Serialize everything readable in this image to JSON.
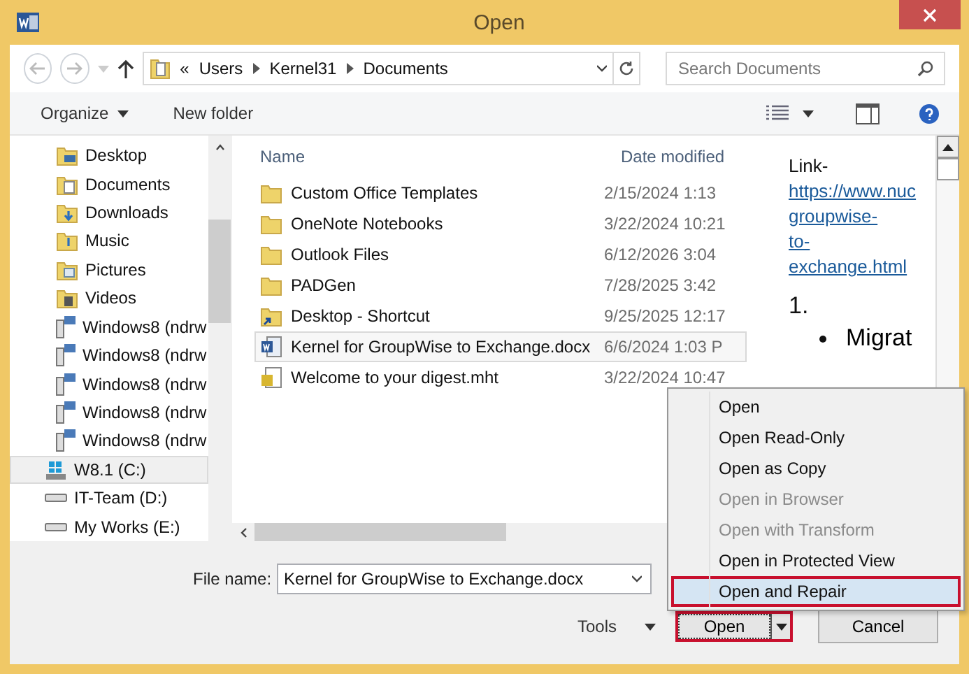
{
  "window": {
    "title": "Open"
  },
  "address": {
    "prefix": "«",
    "crumbs": [
      "Users",
      "Kernel31",
      "Documents"
    ]
  },
  "search": {
    "placeholder": "Search Documents"
  },
  "toolbar": [
    "Organize",
    "New folder"
  ],
  "sidebar": [
    {
      "label": "Desktop",
      "kind": "desktop",
      "selected": false
    },
    {
      "label": "Documents",
      "kind": "documents",
      "selected": false
    },
    {
      "label": "Downloads",
      "kind": "downloads",
      "selected": false
    },
    {
      "label": "Music",
      "kind": "music",
      "selected": false
    },
    {
      "label": "Pictures",
      "kind": "pictures",
      "selected": false
    },
    {
      "label": "Videos",
      "kind": "videos",
      "selected": false
    },
    {
      "label": "Windows8 (ndrw",
      "kind": "network",
      "selected": false
    },
    {
      "label": "Windows8 (ndrw",
      "kind": "network",
      "selected": false
    },
    {
      "label": "Windows8 (ndrw",
      "kind": "network",
      "selected": false
    },
    {
      "label": "Windows8 (ndrw",
      "kind": "network",
      "selected": false
    },
    {
      "label": "Windows8 (ndrw",
      "kind": "network",
      "selected": false
    },
    {
      "label": "W8.1 (C:)",
      "kind": "system-drive",
      "selected": true
    },
    {
      "label": "IT-Team (D:)",
      "kind": "drive",
      "selected": false
    },
    {
      "label": "My Works (E:)",
      "kind": "drive",
      "selected": false
    }
  ],
  "columns": [
    "Name",
    "Date modified"
  ],
  "files": [
    {
      "name": "Custom Office Templates",
      "date": "2/15/2024 1:13",
      "kind": "folder",
      "selected": false
    },
    {
      "name": "OneNote Notebooks",
      "date": "3/22/2024 10:21",
      "kind": "folder",
      "selected": false
    },
    {
      "name": "Outlook Files",
      "date": "6/12/2026 3:04",
      "kind": "folder",
      "selected": false
    },
    {
      "name": "PADGen",
      "date": "7/28/2025 3:42",
      "kind": "folder",
      "selected": false
    },
    {
      "name": "Desktop - Shortcut",
      "date": "9/25/2025 12:17",
      "kind": "shortcut",
      "selected": false
    },
    {
      "name": "Kernel for GroupWise to Exchange.docx",
      "date": "6/6/2024 1:03 P",
      "kind": "word",
      "selected": true
    },
    {
      "name": "Welcome to your digest.mht",
      "date": "3/22/2024 10:47",
      "kind": "web",
      "selected": false
    }
  ],
  "preview": {
    "label": "Link-",
    "link": [
      "https://www.nuc",
      "groupwise-",
      "to-",
      "exchange.html"
    ],
    "number": "1.",
    "bullet": "Migrat"
  },
  "file_name": {
    "label": "File name:",
    "value": "Kernel for GroupWise to Exchange.docx"
  },
  "tools": "Tools",
  "open_button": "Open",
  "cancel_button": "Cancel",
  "menu": [
    {
      "label": "Open",
      "disabled": false,
      "selected": false
    },
    {
      "label": "Open Read-Only",
      "disabled": false,
      "selected": false
    },
    {
      "label": "Open as Copy",
      "disabled": false,
      "selected": false
    },
    {
      "label": "Open in Browser",
      "disabled": true,
      "selected": false
    },
    {
      "label": "Open with Transform",
      "disabled": true,
      "selected": false
    },
    {
      "label": "Open in Protected View",
      "disabled": false,
      "selected": false
    },
    {
      "label": "Open and Repair",
      "disabled": false,
      "selected": true
    }
  ]
}
